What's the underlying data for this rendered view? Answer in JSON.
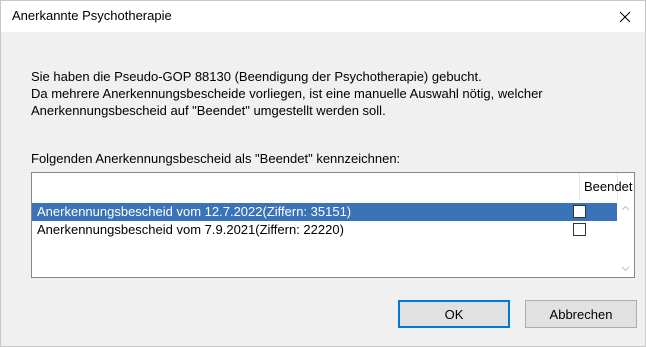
{
  "window": {
    "title": "Anerkannte Psychotherapie"
  },
  "icons": {
    "close": "close-icon",
    "scroll_up": "chevron-up-icon",
    "scroll_down": "chevron-down-icon"
  },
  "message": {
    "line1": "Sie haben die Pseudo-GOP  88130 (Beendigung der Psychotherapie) gebucht.",
    "line2": "Da mehrere Anerkennungsbescheide vorliegen, ist eine manuelle Auswahl nötig, welcher",
    "line3": "Anerkennungsbescheid auf \"Beendet\" umgestellt werden soll."
  },
  "instruction": "Folgenden Anerkennungsbescheid als \"Beendet\" kennzeichnen:",
  "list": {
    "columns": {
      "name": "",
      "beendet": "Beendet"
    },
    "rows": [
      {
        "name": "Anerkennungsbescheid vom 12.7.2022(Ziffern: 35151)",
        "beendet": false,
        "selected": true
      },
      {
        "name": "Anerkennungsbescheid vom 7.9.2021(Ziffern: 22220)",
        "beendet": false,
        "selected": false
      }
    ]
  },
  "buttons": {
    "ok": "OK",
    "cancel": "Abbrechen"
  },
  "colors": {
    "selection": "#3b73b9",
    "dialog_bg": "#f0f0f0",
    "focus_border": "#0078d7"
  }
}
